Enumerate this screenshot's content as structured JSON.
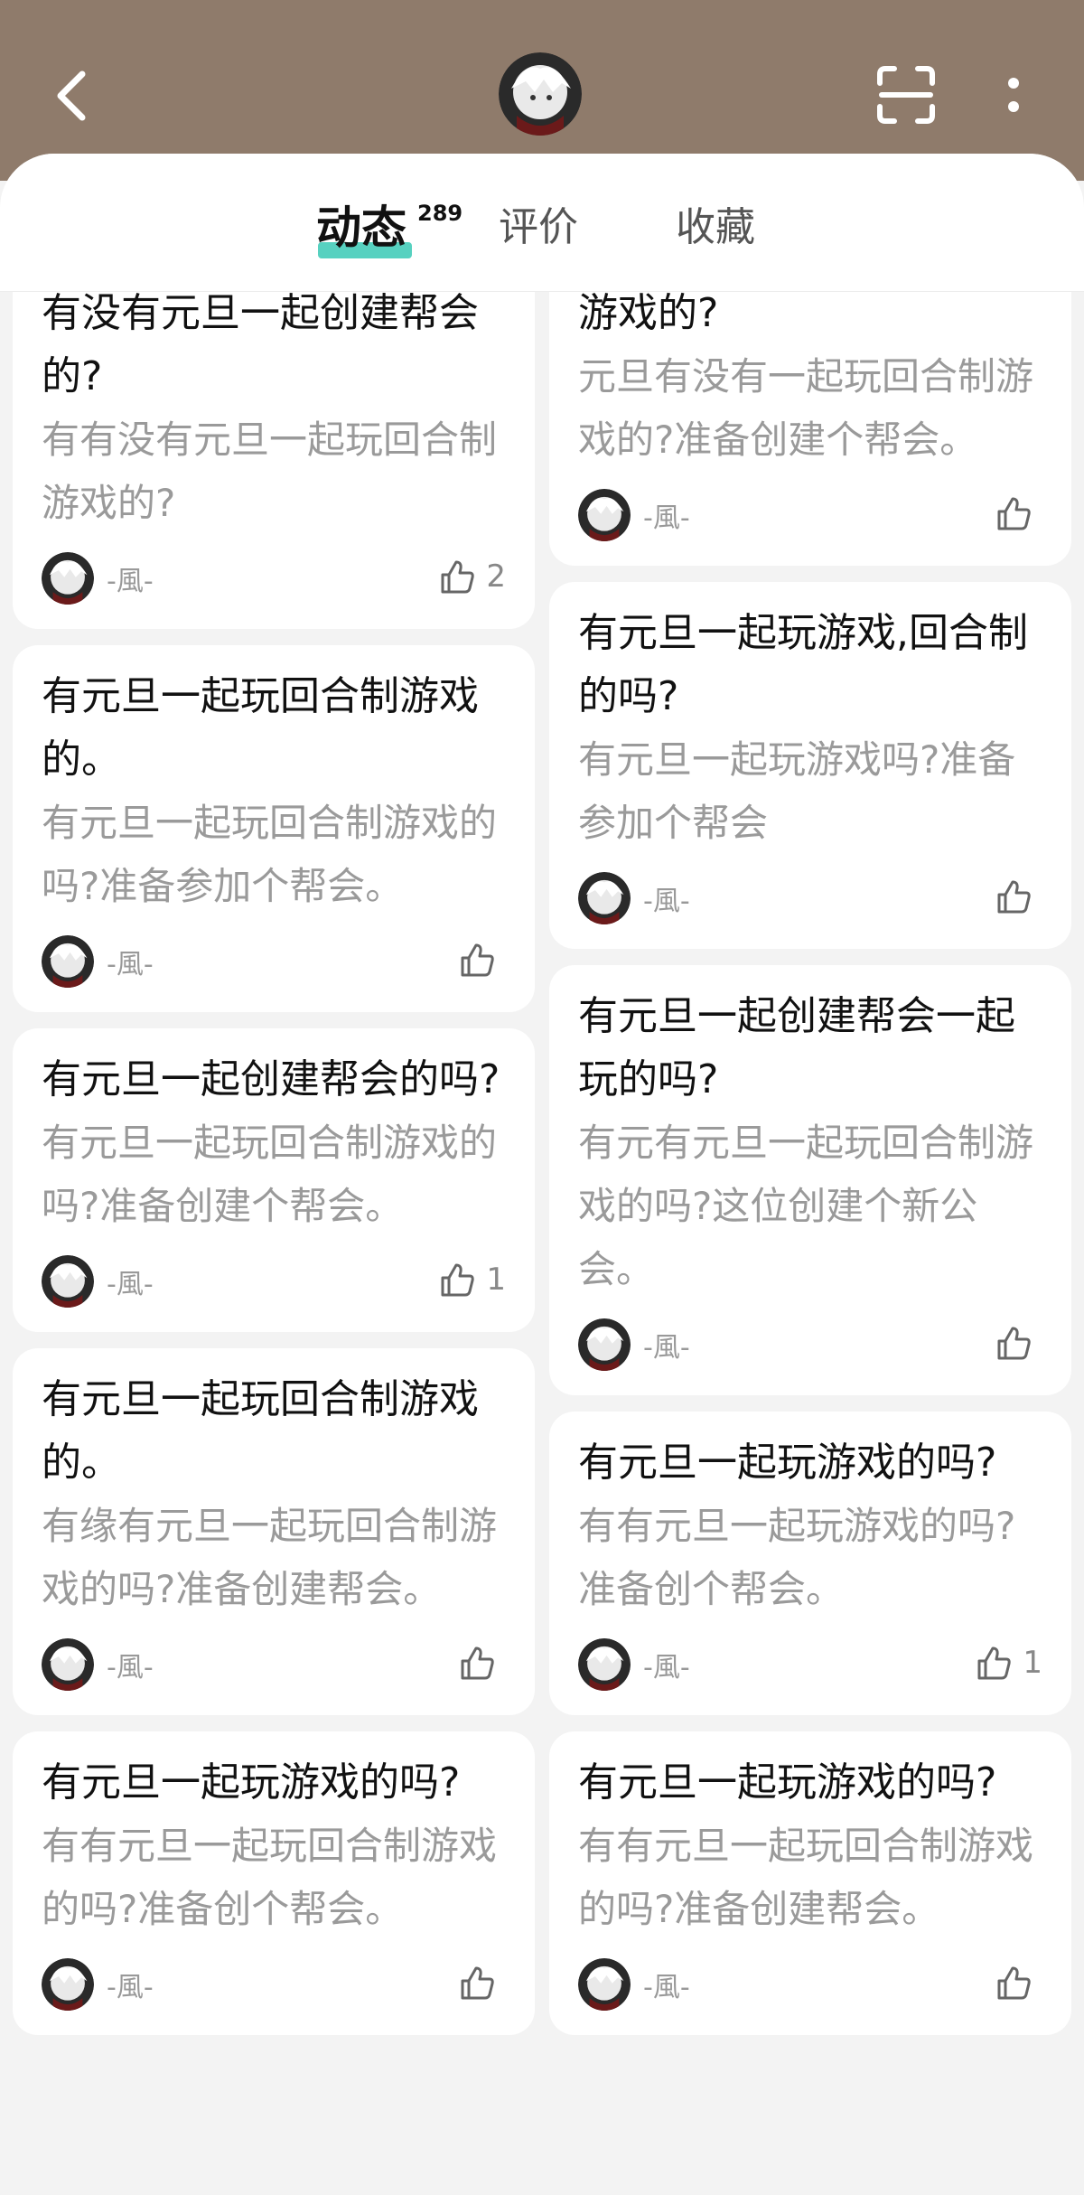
{
  "header": {
    "back_icon": "back-chevron-icon",
    "avatar_icon": "user-avatar",
    "scan_icon": "scan-icon",
    "more_icon": "more-vertical-icon",
    "bg_color": "#8f7b6b"
  },
  "tabs": [
    {
      "label": "动态",
      "count": "289",
      "active": true
    },
    {
      "label": "评价"
    },
    {
      "label": "收藏"
    }
  ],
  "accent_color": "#57d1c0",
  "left_cards": [
    {
      "title": "有没有元旦一起创建帮会的?",
      "body": "有有没有元旦一起玩回合制游戏的?",
      "author": "-風-",
      "likes": "2"
    },
    {
      "title": "有元旦一起玩回合制游戏的。",
      "body": "有元旦一起玩回合制游戏的吗?准备参加个帮会。",
      "author": "-風-",
      "likes": ""
    },
    {
      "title": "有元旦一起创建帮会的吗?",
      "body": "有元旦一起玩回合制游戏的吗?准备创建个帮会。",
      "author": "-風-",
      "likes": "1"
    },
    {
      "title": "有元旦一起玩回合制游戏的。",
      "body": "有缘有元旦一起玩回合制游戏的吗?准备创建帮会。",
      "author": "-風-",
      "likes": ""
    },
    {
      "title": "有元旦一起玩游戏的吗?",
      "body": "有有元旦一起玩回合制游戏的吗?准备创个帮会。",
      "author": "-風-",
      "likes": ""
    }
  ],
  "right_cards": [
    {
      "title": "游戏的?",
      "body": "元旦有没有一起玩回合制游戏的?准备创建个帮会。",
      "author": "-風-",
      "likes": ""
    },
    {
      "title": "有元旦一起玩游戏,回合制的吗?",
      "body": "有元旦一起玩游戏吗?准备参加个帮会",
      "author": "-風-",
      "likes": ""
    },
    {
      "title": "有元旦一起创建帮会一起玩的吗?",
      "body": "有元有元旦一起玩回合制游戏的吗?这位创建个新公会。",
      "author": "-風-",
      "likes": ""
    },
    {
      "title": "有元旦一起玩游戏的吗?",
      "body": "有有元旦一起玩游戏的吗?准备创个帮会。",
      "author": "-風-",
      "likes": "1"
    },
    {
      "title": "有元旦一起玩游戏的吗?",
      "body": "有有元旦一起玩回合制游戏的吗?准备创建帮会。",
      "author": "-風-",
      "likes": ""
    }
  ]
}
